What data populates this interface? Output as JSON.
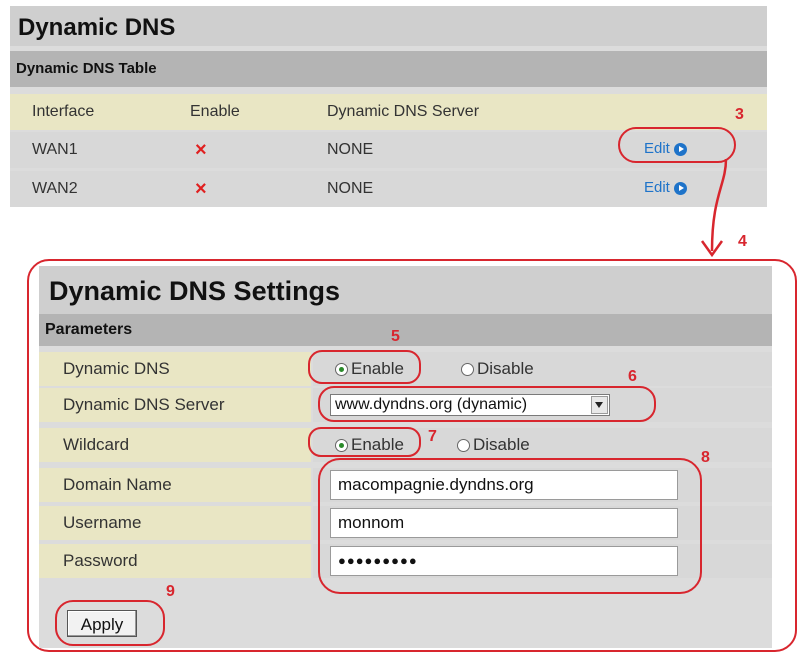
{
  "table_panel": {
    "title": "Dynamic DNS",
    "subtitle": "Dynamic DNS Table",
    "columns": [
      "Interface",
      "Enable",
      "Dynamic DNS Server"
    ],
    "rows": [
      {
        "interface": "WAN1",
        "enable": "×",
        "server": "NONE",
        "action": "Edit"
      },
      {
        "interface": "WAN2",
        "enable": "×",
        "server": "NONE",
        "action": "Edit"
      }
    ]
  },
  "settings_panel": {
    "title": "Dynamic DNS Settings",
    "subtitle": "Parameters",
    "dynamic_dns": {
      "label": "Dynamic DNS",
      "enable": "Enable",
      "disable": "Disable",
      "selected": "Enable"
    },
    "server": {
      "label": "Dynamic DNS Server",
      "value": "www.dyndns.org (dynamic)"
    },
    "wildcard": {
      "label": "Wildcard",
      "enable": "Enable",
      "disable": "Disable",
      "selected": "Enable"
    },
    "domain": {
      "label": "Domain Name",
      "value": "macompagnie.dyndns.org"
    },
    "username": {
      "label": "Username",
      "value": "monnom"
    },
    "password": {
      "label": "Password",
      "value": "●●●●●●●●●"
    },
    "apply_label": "Apply"
  },
  "annotations": {
    "n3": "3",
    "n4": "4",
    "n5": "5",
    "n6": "6",
    "n7": "7",
    "n8": "8",
    "n9": "9"
  },
  "colors": {
    "accent_red": "#d8262e",
    "link_blue": "#1e73c9",
    "header_bg": "#cfcfcf",
    "label_bg": "#e9e6c4"
  }
}
